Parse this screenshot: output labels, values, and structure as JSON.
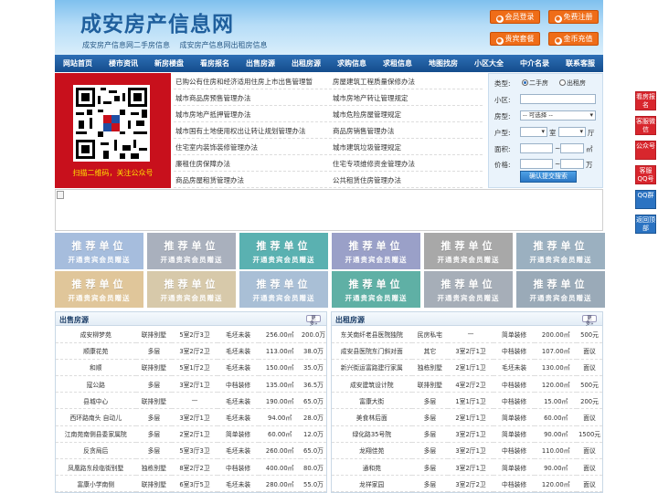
{
  "header": {
    "logo": "成安房产信息网",
    "sub1": "成安房产信息网二手房信息",
    "sub2": "成安房产信息网出租房信息",
    "buttons": [
      {
        "label": "会员登录",
        "icon": "user-icon"
      },
      {
        "label": "免费注册",
        "icon": "register-icon"
      },
      {
        "label": "贵宾套餐",
        "icon": "vip-icon"
      },
      {
        "label": "金币充值",
        "icon": "coin-icon"
      }
    ]
  },
  "nav": [
    "网站首页",
    "楼市资讯",
    "新房楼盘",
    "看房报名",
    "出售房源",
    "出租房源",
    "求购信息",
    "求租信息",
    "地图找房",
    "小区大全",
    "中介名录",
    "联系客服"
  ],
  "qr": {
    "caption": "扫描二维码，关注公众号"
  },
  "links": {
    "left": [
      "已购公有住房和经济适用住房上市出售管理暂",
      "城市商品房预售管理办法",
      "城市房地产抵押管理办法",
      "城市国有土地使用权出让转让规划管理办法",
      "住宅室内装饰装修管理办法",
      "廉租住房保障办法",
      "商品房屋租赁管理办法"
    ],
    "right": [
      "房屋建筑工程质量保修办法",
      "城市房地产转让管理规定",
      "城市危险房屋管理规定",
      "商品房销售管理办法",
      "城市建筑垃圾管理规定",
      "住宅专项维修资金管理办法",
      "公共租赁住房管理办法"
    ]
  },
  "search": {
    "type_label": "类型:",
    "radio_second_hand": "二手房",
    "radio_rent": "出租房",
    "area_label": "小区:",
    "house_type_label": "房型:",
    "house_type_value": "-- 可选择 --",
    "layout_label": "户型:",
    "room_unit": "室",
    "hall_unit": "厅",
    "size_label": "面积:",
    "size_unit": "㎡",
    "range_sep": "~",
    "price_label": "价格:",
    "price_unit": "万",
    "submit": "确认提交搜索"
  },
  "ads": {
    "title": "推荐单位",
    "sub": "开通贵宾会员赠送",
    "colors": [
      "#a6bddd",
      "#a9b0bd",
      "#5ab1b1",
      "#9aa0c8",
      "#a8a8a8",
      "#9bb0c0",
      "#e0c69a",
      "#d7c9aa",
      "#a9bfd6",
      "#5fb0a5",
      "#a6aeb8",
      "#9aaab8"
    ]
  },
  "sale": {
    "title": "出售房源",
    "more": "更多»",
    "rows": [
      [
        "成安柳梦苑",
        "联排别墅",
        "5室2厅3卫",
        "毛坯未装",
        "256.00㎡",
        "200.0万"
      ],
      [
        "顺康花苑",
        "多层",
        "3室2厅2卫",
        "毛坯未装",
        "113.00㎡",
        "38.0万"
      ],
      [
        "和顺",
        "联排别墅",
        "5室1厅2卫",
        "毛坯未装",
        "150.00㎡",
        "35.0万"
      ],
      [
        "寇公路",
        "多层",
        "3室2厅1卫",
        "中档装修",
        "135.00㎡",
        "36.5万"
      ],
      [
        "县城中心",
        "联排别墅",
        "—",
        "毛坯未装",
        "190.00㎡",
        "65.0万"
      ],
      [
        "西环路南头 自动儿",
        "多层",
        "3室2厅1卫",
        "毛坯未装",
        "94.00㎡",
        "28.0万"
      ],
      [
        "江南苑南侧县委家属院",
        "多层",
        "2室2厅1卫",
        "简单装修",
        "60.00㎡",
        "12.0万"
      ],
      [
        "反贪局后",
        "多层",
        "5室3厅3卫",
        "毛坯未装",
        "260.00㎡",
        "65.0万"
      ],
      [
        "凤凰路东段临街别墅",
        "独栋别墅",
        "8室2厅2卫",
        "中档装修",
        "400.00㎡",
        "80.0万"
      ],
      [
        "富康小学南侧",
        "联排别墅",
        "6室3厅5卫",
        "毛坯未装",
        "280.00㎡",
        "55.0万"
      ]
    ]
  },
  "rent": {
    "title": "出租房源",
    "more": "更多»",
    "rows": [
      [
        "东关南纤老县医院独院",
        "民房私宅",
        "—",
        "简单装修",
        "200.00㎡",
        "500元"
      ],
      [
        "成安县医院东门斜对面",
        "其它",
        "3室2厅1卫",
        "中档装修",
        "107.00㎡",
        "面议"
      ],
      [
        "新兴街运富路建行家属",
        "独栋别墅",
        "2室1厅1卫",
        "毛坯未装",
        "130.00㎡",
        "面议"
      ],
      [
        "成安建筑设计院",
        "联排别墅",
        "4室2厅2卫",
        "中档装修",
        "120.00㎡",
        "500元"
      ],
      [
        "富康大街",
        "多层",
        "1室1厅1卫",
        "中档装修",
        "15.00㎡",
        "200元"
      ],
      [
        "美食林后面",
        "多层",
        "2室1厅1卫",
        "简单装修",
        "60.00㎡",
        "面议"
      ],
      [
        "绿化路35号院",
        "多层",
        "3室2厅1卫",
        "简单装修",
        "90.00㎡",
        "1500元"
      ],
      [
        "龙翔佳苑",
        "多层",
        "3室2厅1卫",
        "中档装修",
        "110.00㎡",
        "面议"
      ],
      [
        "通和苑",
        "多层",
        "3室2厅1卫",
        "简单装修",
        "90.00㎡",
        "面议"
      ],
      [
        "龙祥家园",
        "多层",
        "3室2厅2卫",
        "中档装修",
        "120.00㎡",
        "面议"
      ]
    ]
  },
  "float": [
    "看房报名",
    "客服微信",
    "公众号",
    "客服QQ号",
    "QQ群",
    "返回顶部"
  ]
}
